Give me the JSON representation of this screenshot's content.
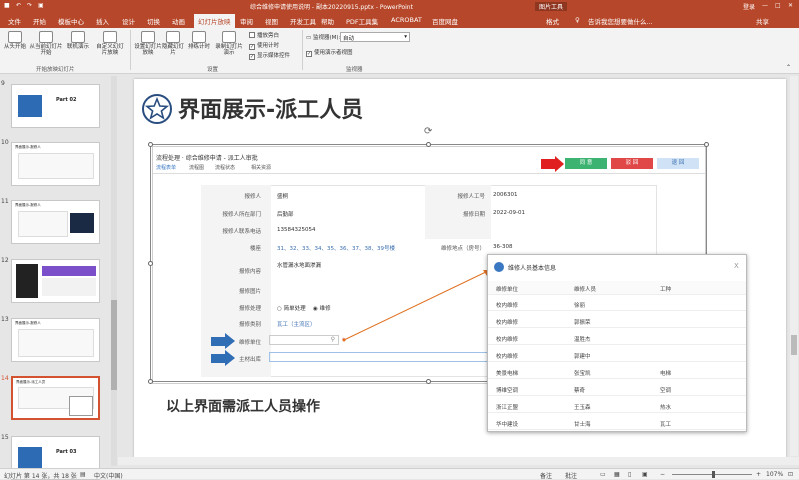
{
  "window": {
    "title": "综合维修申请使用说明 - 副本20220915.pptx - PowerPoint",
    "tool_context": "图片工具",
    "login": "登录",
    "share": "共享",
    "tell_me": "告诉我您想要做什么..."
  },
  "tabs": [
    "文件",
    "开始",
    "模板中心",
    "插入",
    "设计",
    "切换",
    "动画",
    "幻灯片放映",
    "审阅",
    "视图",
    "开发工具",
    "帮助",
    "PDF工具集",
    "ACROBAT",
    "百度网盘",
    "格式"
  ],
  "active_tab": "幻灯片放映",
  "ribbon": {
    "buttons": [
      "从头开始",
      "从当前幻灯片开始",
      "联机演示",
      "自定义幻灯片放映",
      "设置幻灯片放映",
      "隐藏幻灯片",
      "排练计时",
      "录制幻灯片演示"
    ],
    "checks": [
      {
        "label": "播放旁白",
        "checked": false
      },
      {
        "label": "使用计时",
        "checked": true
      },
      {
        "label": "显示媒体控件",
        "checked": true
      }
    ],
    "monitor_label": "监视器(M):",
    "monitor_value": "自动",
    "presenter_view": "使用演示者视图",
    "groups": [
      "开始放映幻灯片",
      "设置",
      "监视器"
    ]
  },
  "thumbnails": [
    {
      "num": "9",
      "title": "Part 02",
      "active": false
    },
    {
      "num": "10",
      "title": "界面展示-报修人",
      "active": false
    },
    {
      "num": "11",
      "title": "界面展示-报修人",
      "active": false
    },
    {
      "num": "12",
      "title": "",
      "active": false
    },
    {
      "num": "13",
      "title": "界面展示-报修人",
      "active": false
    },
    {
      "num": "14",
      "title": "界面展示-派工人员",
      "active": true
    },
    {
      "num": "15",
      "title": "Part 03",
      "active": false
    }
  ],
  "slide": {
    "title": "界面展示-派工人员",
    "caption": "以上界面需派工人员操作"
  },
  "form": {
    "breadcrumb": "流程处理 · 综合维修申请 - 派工人审批",
    "tabs": [
      "流程表单",
      "流程图",
      "流程状态",
      "相关资源"
    ],
    "actions": [
      "同 意",
      "驳 回",
      "退 回"
    ],
    "rows": [
      {
        "l1": "报修人",
        "v1": "盛桐",
        "l2": "报修人工号",
        "v2": "2006301"
      },
      {
        "l1": "报修人所在部门",
        "v1": "后勤部",
        "l2": "报修日期",
        "v2": "2022-09-01"
      },
      {
        "l1": "报修人联系电话",
        "v1": "13584325054",
        "l2": "",
        "": "",
        "v2": ""
      },
      {
        "l1": "楼座",
        "v1": "31、32、33、34、35、36、37、38、39号楼",
        "l2": "维修地点（房号）",
        "v2": "36-308"
      },
      {
        "l1": "报修内容",
        "v1": "水管漏水地面渗漏",
        "l2": "",
        "v2": ""
      },
      {
        "l1": "报修图片",
        "v1": "",
        "l2": "",
        "v2": ""
      },
      {
        "l1": "报修处理",
        "v1": "",
        "l2": "",
        "v2": ""
      },
      {
        "l1": "报修类别",
        "v1": "瓦工（主流区）",
        "l2": "",
        "v2": ""
      },
      {
        "l1": "维修单位",
        "v1": "",
        "l2": "",
        "v2": ""
      },
      {
        "l1": "主材出库",
        "v1": "",
        "l2": "",
        "v2": ""
      }
    ],
    "radio_options": [
      "简单处理",
      "维修"
    ]
  },
  "popup": {
    "title": "维修人员基本信息",
    "close": "X",
    "headers": [
      "维修单位",
      "维修人员",
      "工种"
    ],
    "rows": [
      [
        "校内维修",
        "徐丽",
        ""
      ],
      [
        "校内维修",
        "郭振荣",
        ""
      ],
      [
        "校内维修",
        "温胜杰",
        ""
      ],
      [
        "校内维修",
        "郭建中",
        ""
      ],
      [
        "美景电梯",
        "张宝凯",
        "电梯"
      ],
      [
        "博维空调",
        "蔡奇",
        "空调"
      ],
      [
        "浙江正盟",
        "王玉森",
        "热水"
      ],
      [
        "华中建设",
        "甘士海",
        "瓦工"
      ]
    ]
  },
  "status": {
    "slide_info": "幻灯片 第 14 张，共 18 张",
    "language": "中文(中国)",
    "notes": "备注",
    "comments": "批注",
    "zoom": "107%"
  },
  "colors": {
    "accent": "#b7472a",
    "approve": "#3cb371",
    "reject": "#e04848",
    "back": "#b8d3f0",
    "arrow_blue": "#2f6db5",
    "arrow_red": "#e02020",
    "link": "#e07020"
  }
}
